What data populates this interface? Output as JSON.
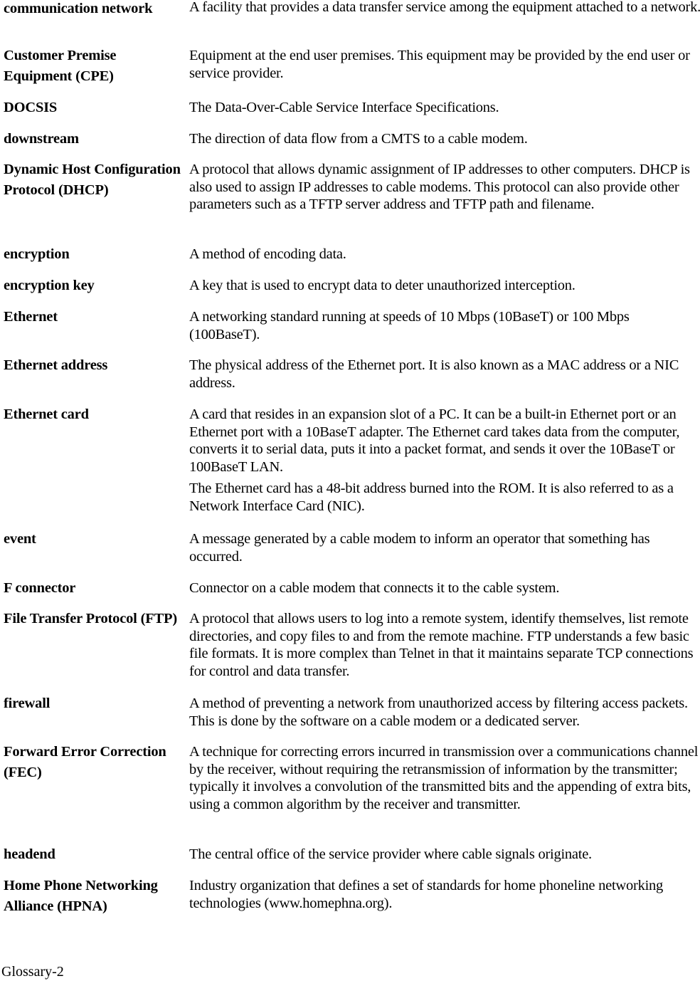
{
  "glossary": {
    "entries": [
      {
        "term": "communication network",
        "definition": [
          "A facility that provides a data transfer service among the equipment attached to a network."
        ]
      },
      {
        "term": "Customer Premise Equipment (CPE)",
        "definition": [
          "Equipment at the end user premises. This equipment may be provided by the end user or service provider."
        ]
      },
      {
        "term": "DOCSIS",
        "definition": [
          "The Data-Over-Cable Service Interface Specifications."
        ]
      },
      {
        "term": "downstream",
        "definition": [
          "The direction of data flow from a CMTS to a cable modem."
        ]
      },
      {
        "term": "Dynamic Host Configuration Protocol (DHCP)",
        "definition": [
          "A protocol that allows dynamic assignment of IP addresses to other computers. DHCP is also used to assign IP addresses to cable modems. This protocol can also provide other parameters such as a TFTP server address and TFTP path and filename."
        ]
      },
      {
        "term": "encryption",
        "definition": [
          "A method of encoding data."
        ]
      },
      {
        "term": "encryption key",
        "definition": [
          "A key that is used to encrypt data to deter unauthorized interception."
        ]
      },
      {
        "term": "Ethernet",
        "definition": [
          "A networking standard running at speeds of 10 Mbps (10BaseT) or 100 Mbps (100BaseT)."
        ]
      },
      {
        "term": "Ethernet address",
        "definition": [
          "The physical address of the Ethernet port. It is also known as a MAC address or a NIC address."
        ]
      },
      {
        "term": "Ethernet card",
        "definition": [
          "A card that resides in an expansion slot of a PC. It can be a built-in Ethernet port or an Ethernet port with a 10BaseT adapter. The Ethernet card takes data from the computer, converts it to serial data, puts it into a packet format, and sends it over the 10BaseT or 100BaseT LAN.",
          "The Ethernet card has a 48-bit address burned into the ROM. It is also referred to as a Network Interface Card (NIC)."
        ]
      },
      {
        "term": "event",
        "definition": [
          "A message generated by a cable modem to inform an operator that something has occurred."
        ]
      },
      {
        "term": "F connector",
        "definition": [
          "Connector on a cable modem that connects it to the cable system."
        ]
      },
      {
        "term": "File Transfer Protocol (FTP)",
        "definition": [
          "A protocol that allows users to log into a remote system, identify themselves, list remote directories, and copy files to and from the remote machine. FTP understands a few basic file formats. It is more complex than Telnet in that it maintains separate TCP connections for control and data transfer."
        ]
      },
      {
        "term": "firewall",
        "definition": [
          "A method of preventing a network from unauthorized access by filtering access packets. This is done by the software on a cable modem or a dedicated server."
        ]
      },
      {
        "term": "Forward Error Correction (FEC)",
        "definition": [
          "A technique for correcting errors incurred in transmission over a communications channel by the receiver, without requiring the retransmission of information by the transmitter; typically it involves a convolution of the transmitted bits and the appending of extra bits, using a common algorithm by the receiver and transmitter."
        ]
      },
      {
        "term": "headend",
        "definition": [
          "The central office of the service provider where cable signals originate."
        ]
      },
      {
        "term": "Home Phone Networking Alliance (HPNA)",
        "definition": [
          "Industry organization that defines a set of standards for home phoneline networking technologies (www.homephna.org)."
        ]
      }
    ]
  },
  "footer": {
    "page_label": "Glossary-2"
  }
}
